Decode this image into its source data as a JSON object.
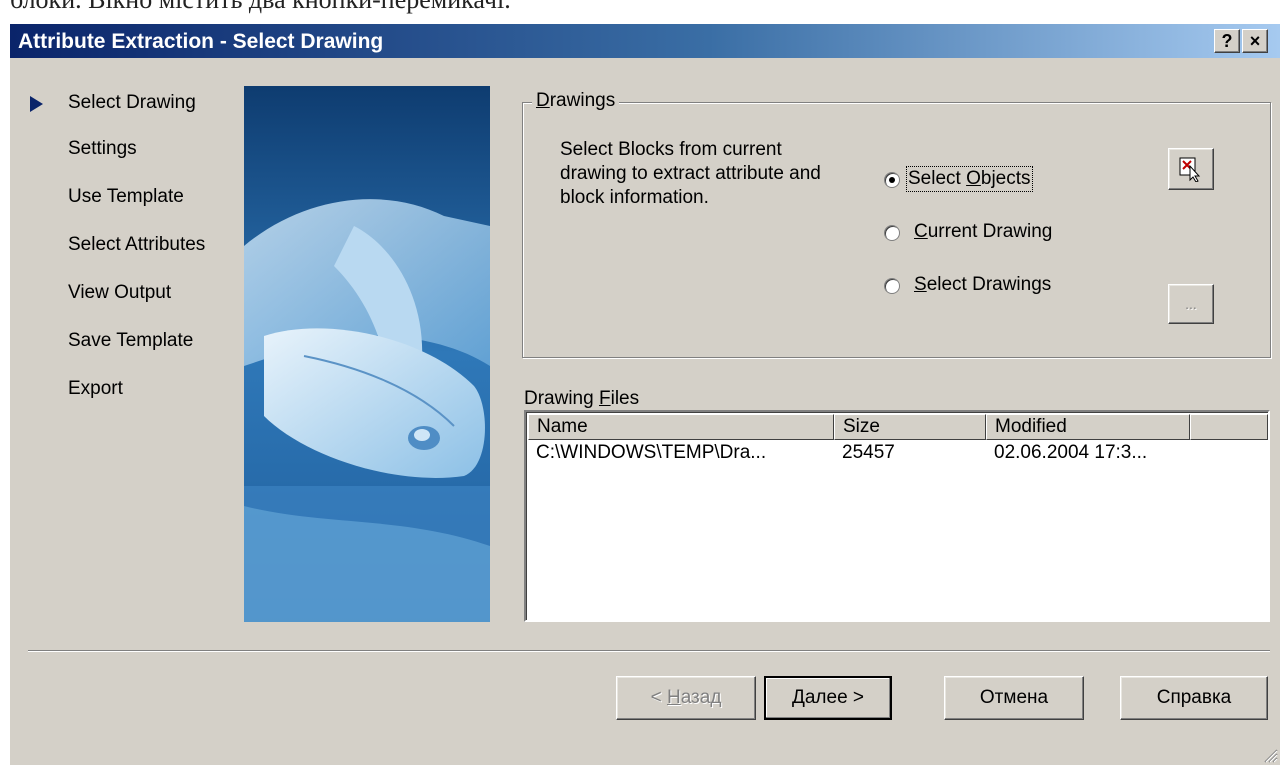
{
  "top_strip_text": "блоки. Вікно містить два кнопки-перемикачі.",
  "window": {
    "title": "Attribute Extraction - Select Drawing",
    "help_button": "?",
    "close_button": "×"
  },
  "steps": [
    {
      "label": "Select Drawing",
      "current": true
    },
    {
      "label": "Settings",
      "current": false
    },
    {
      "label": "Use Template",
      "current": false
    },
    {
      "label": "Select Attributes",
      "current": false
    },
    {
      "label": "View Output",
      "current": false
    },
    {
      "label": "Save Template",
      "current": false
    },
    {
      "label": "Export",
      "current": false
    }
  ],
  "drawings_group": {
    "legend_mnemonic": "D",
    "legend_rest": "rawings",
    "description": "Select Blocks from current drawing to extract attribute and block information.",
    "options": [
      {
        "before": "Select ",
        "mnemonic": "O",
        "after": "bjects",
        "checked": true
      },
      {
        "before": "",
        "mnemonic": "C",
        "after": "urrent Drawing",
        "checked": false
      },
      {
        "before": "",
        "mnemonic": "S",
        "after": "elect Drawings",
        "checked": false
      }
    ],
    "browse_label": "..."
  },
  "drawing_files": {
    "label_before": "Drawing ",
    "label_mnemonic": "F",
    "label_after": "iles",
    "columns": [
      "Name",
      "Size",
      "Modified"
    ],
    "rows": [
      {
        "name": "C:\\WINDOWS\\TEMP\\Dra...",
        "size": "25457",
        "modified": "02.06.2004 17:3..."
      }
    ]
  },
  "buttons": {
    "back_prefix": "< ",
    "back_mnemonic": "Н",
    "back_rest": "азад",
    "next": "Далее >",
    "cancel": "Отмена",
    "help": "Справка"
  },
  "icons": {
    "select_objects_button": "pick-cursor-icon",
    "nav_arrow": "triangle-right-icon"
  }
}
